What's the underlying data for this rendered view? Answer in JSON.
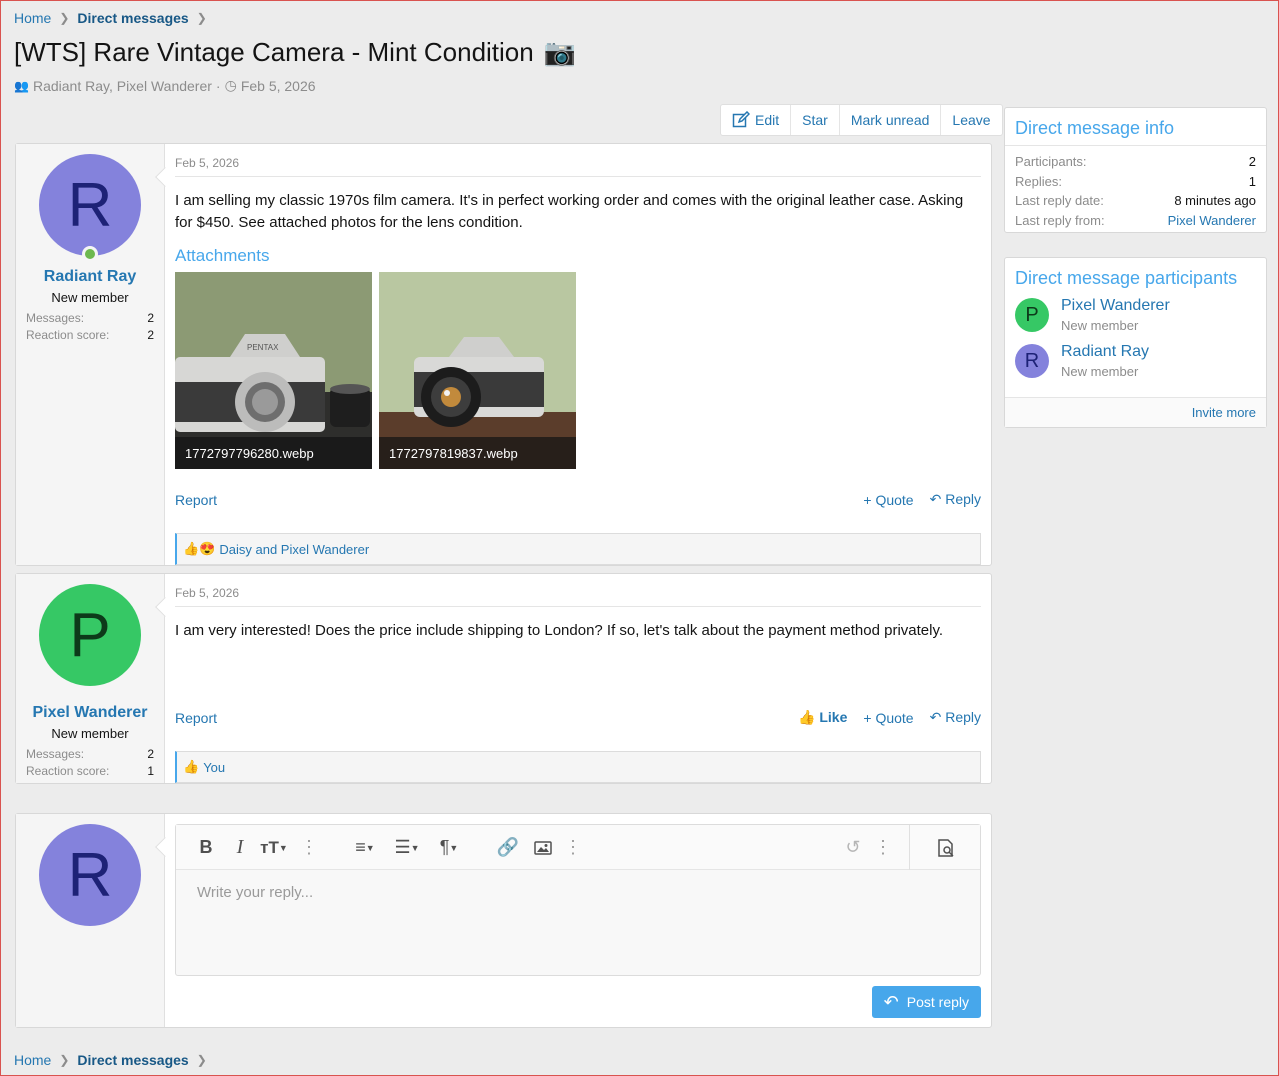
{
  "breadcrumb": {
    "home": "Home",
    "section": "Direct messages"
  },
  "thread": {
    "title": "[WTS] Rare Vintage Camera - Mint Condition",
    "title_emoji": "📷",
    "participants_text": "Radiant Ray, Pixel Wanderer",
    "date": "Feb 5, 2026"
  },
  "toolbar": {
    "edit": "Edit",
    "star": "Star",
    "mark_unread": "Mark unread",
    "leave": "Leave"
  },
  "messages": [
    {
      "avatar_letter": "R",
      "username": "Radiant Ray",
      "user_title": "New member",
      "messages_label": "Messages:",
      "messages_value": "2",
      "reaction_label": "Reaction score:",
      "reaction_value": "2",
      "date": "Feb 5, 2026",
      "body": "I am selling my classic 1970s film camera. It's in perfect working order and comes with the original leather case. Asking for $450. See attached photos for the lens condition.",
      "attachments_title": "Attachments",
      "attachments": [
        "1772797796280.webp",
        "1772797819837.webp"
      ],
      "report": "Report",
      "quote": "Quote",
      "reply": "Reply",
      "reactions_text": "Daisy and Pixel Wanderer",
      "reaction_emojis": "👍😍"
    },
    {
      "avatar_letter": "P",
      "username": "Pixel Wanderer",
      "user_title": "New member",
      "messages_label": "Messages:",
      "messages_value": "2",
      "reaction_label": "Reaction score:",
      "reaction_value": "1",
      "date": "Feb 5, 2026",
      "body": "I am very interested! Does the price include shipping to London? If so, let's talk about the payment method privately.",
      "report": "Report",
      "like": "Like",
      "quote": "Quote",
      "reply": "Reply",
      "reactions_text": "You",
      "reaction_emojis": "👍"
    }
  ],
  "reply_box": {
    "avatar_letter": "R",
    "placeholder": "Write your reply...",
    "post_button": "Post reply"
  },
  "sidebar": {
    "info_title": "Direct message info",
    "info": [
      {
        "label": "Participants:",
        "value": "2"
      },
      {
        "label": "Replies:",
        "value": "1"
      },
      {
        "label": "Last reply date:",
        "value": "8 minutes ago"
      },
      {
        "label": "Last reply from:",
        "value": "Pixel Wanderer"
      }
    ],
    "participants_title": "Direct message participants",
    "participants": [
      {
        "letter": "P",
        "name": "Pixel Wanderer",
        "title": "New member"
      },
      {
        "letter": "R",
        "name": "Radiant Ray",
        "title": "New member"
      }
    ],
    "invite_more": "Invite more"
  },
  "colors": {
    "accent": "#2577b1",
    "title_blue": "#47a7eb",
    "avatar_r": "#8482dc",
    "avatar_p": "#36c865"
  }
}
